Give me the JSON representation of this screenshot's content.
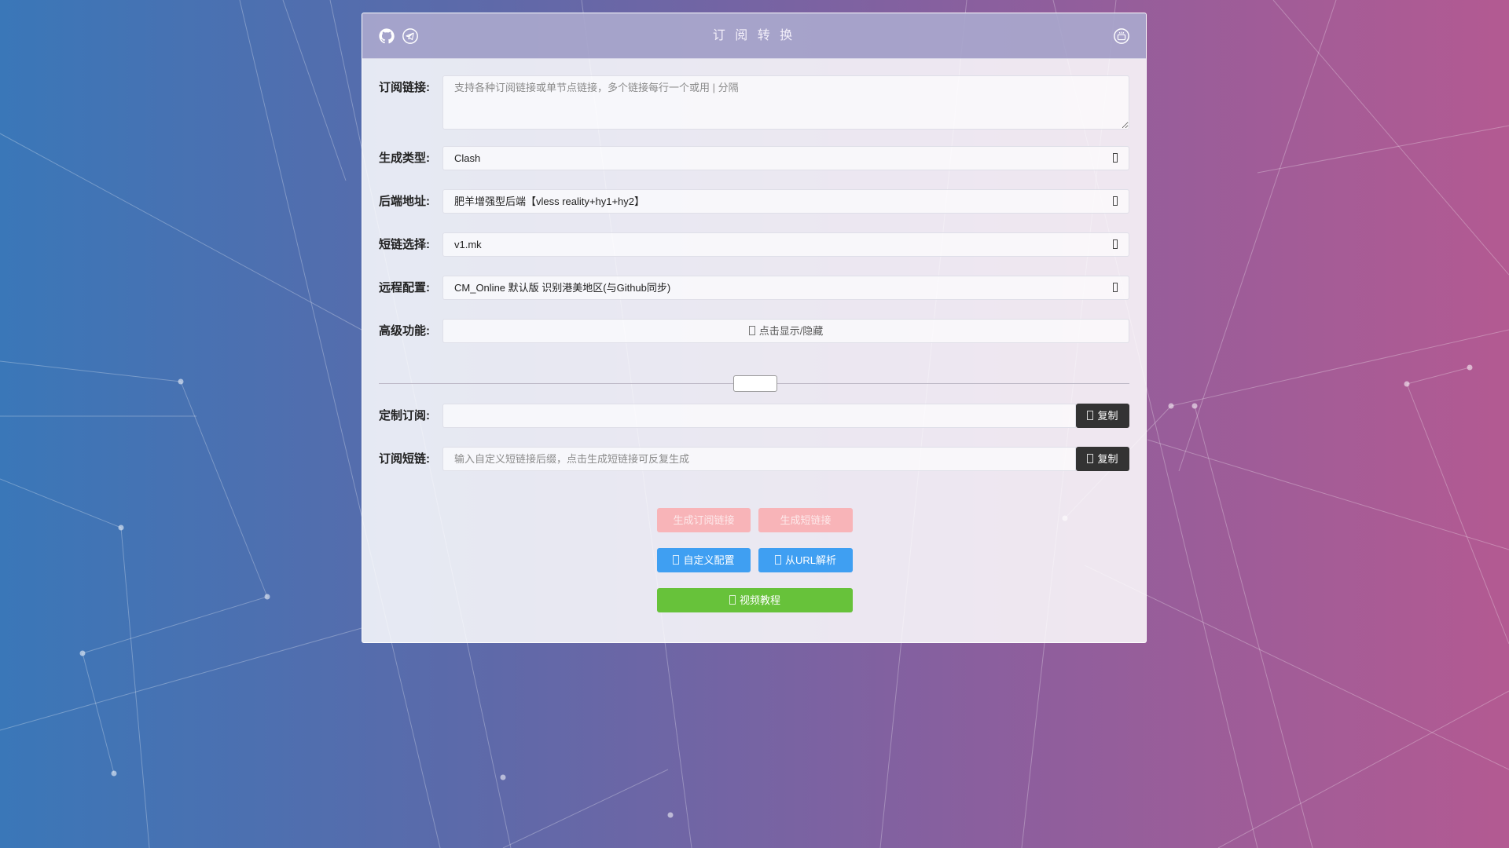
{
  "header": {
    "title": "订 阅 转 换",
    "left_icons": [
      "github-icon",
      "telegram-icon"
    ],
    "right_icon": "youtube-icon"
  },
  "form": {
    "subscription": {
      "label": "订阅链接:",
      "placeholder": "支持各种订阅链接或单节点链接，多个链接每行一个或用 | 分隔"
    },
    "target": {
      "label": "生成类型:",
      "value": "Clash"
    },
    "backend": {
      "label": "后端地址:",
      "value": "肥羊增强型后端【vless reality+hy1+hy2】"
    },
    "shortlink_service": {
      "label": "短链选择:",
      "value": "v1.mk"
    },
    "remote_config": {
      "label": "远程配置:",
      "value": "CM_Online 默认版 识别港美地区(与Github同步)"
    },
    "advanced": {
      "label": "高级功能:",
      "toggle_text": "点击显示/隐藏"
    },
    "custom_sub": {
      "label": "定制订阅:",
      "value": "",
      "copy_label": "复制"
    },
    "short_sub": {
      "label": "订阅短链:",
      "placeholder": "输入自定义短链接后缀，点击生成短链接可反复生成",
      "copy_label": "复制"
    }
  },
  "actions": {
    "generate_sub": "生成订阅链接",
    "generate_short": "生成短链接",
    "custom_config": "自定义配置",
    "parse_url": "从URL解析",
    "video_tutorial": "视频教程"
  },
  "colors": {
    "pink": "#f8b4b8",
    "blue": "#3f9ff2",
    "green": "#67c23a",
    "dark": "#333333"
  }
}
